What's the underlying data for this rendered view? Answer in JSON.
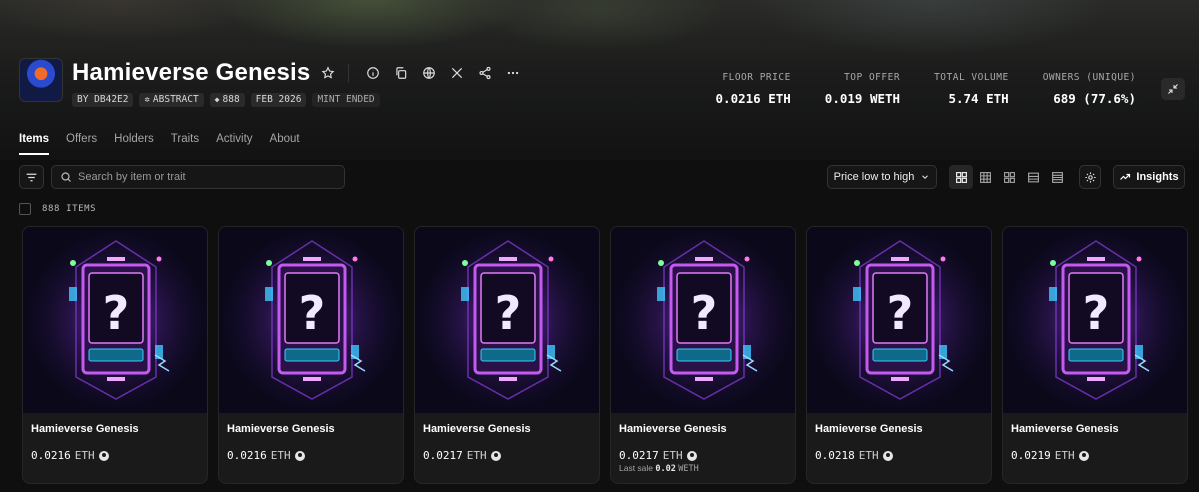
{
  "collection": {
    "title": "Hamieverse Genesis",
    "tags": {
      "creator": "BY DB42E2",
      "chain": "ABSTRACT",
      "supply": "888",
      "date": "FEB 2026",
      "status": "MINT ENDED"
    }
  },
  "stats": [
    {
      "label": "FLOOR PRICE",
      "value": "0.0216 ETH"
    },
    {
      "label": "TOP OFFER",
      "value": "0.019 WETH"
    },
    {
      "label": "TOTAL VOLUME",
      "value": "5.74 ETH"
    },
    {
      "label": "OWNERS (UNIQUE)",
      "value": "689 (77.6%)"
    }
  ],
  "tabs": [
    "Items",
    "Offers",
    "Holders",
    "Traits",
    "Activity",
    "About"
  ],
  "toolbar": {
    "search_placeholder": "Search by item or trait",
    "sort_label": "Price low to high",
    "insights_label": "Insights"
  },
  "items_count": "888 ITEMS",
  "cards": [
    {
      "name": "Hamieverse Genesis",
      "price": "0.0216",
      "currency": "ETH",
      "last_sale": null
    },
    {
      "name": "Hamieverse Genesis",
      "price": "0.0216",
      "currency": "ETH",
      "last_sale": null
    },
    {
      "name": "Hamieverse Genesis",
      "price": "0.0217",
      "currency": "ETH",
      "last_sale": null
    },
    {
      "name": "Hamieverse Genesis",
      "price": "0.0217",
      "currency": "ETH",
      "last_sale": {
        "label": "Last sale",
        "value": "0.02",
        "currency": "WETH"
      }
    },
    {
      "name": "Hamieverse Genesis",
      "price": "0.0218",
      "currency": "ETH",
      "last_sale": null
    },
    {
      "name": "Hamieverse Genesis",
      "price": "0.0219",
      "currency": "ETH",
      "last_sale": null
    }
  ],
  "colors": {
    "background": "#0f0f10",
    "card_glow": "#b04ae0",
    "card_accent": "#3ec8ff"
  }
}
